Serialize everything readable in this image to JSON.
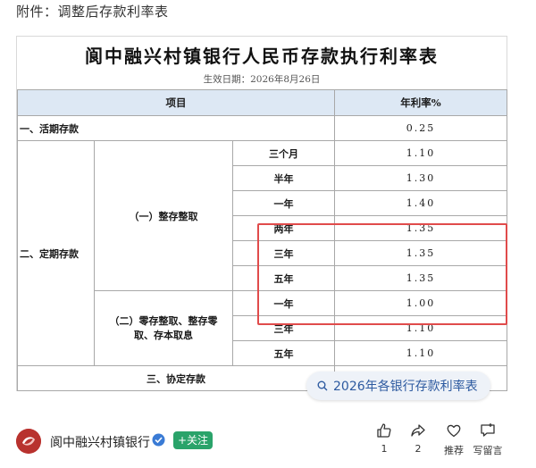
{
  "header": {
    "attachment_label": "附件：调整后存款利率表"
  },
  "document": {
    "title": "阆中融兴村镇银行人民币存款执行利率表",
    "effective_date": "生效日期：2026年8月26日",
    "table": {
      "col_item": "项目",
      "col_rate": "年利率%",
      "demand": {
        "label": "一、活期存款",
        "rate": "0.25"
      },
      "time_deposit_label": "二、定期存款",
      "lump_sum": {
        "label": "（一）整存整取",
        "rows": [
          {
            "term": "三个月",
            "rate": "1.10"
          },
          {
            "term": "半年",
            "rate": "1.30"
          },
          {
            "term": "一年",
            "rate": "1.40"
          },
          {
            "term": "两年",
            "rate": "1.35"
          },
          {
            "term": "三年",
            "rate": "1.35"
          },
          {
            "term": "五年",
            "rate": "1.35"
          }
        ]
      },
      "installment": {
        "label": "（二）零存整取、整存零取、存本取息",
        "rows": [
          {
            "term": "一年",
            "rate": "1.00"
          },
          {
            "term": "三年",
            "rate": "1.10"
          },
          {
            "term": "五年",
            "rate": "1.10"
          }
        ]
      },
      "negotiated": {
        "label": "三、协定存款"
      }
    }
  },
  "search_suggestion": {
    "text": "2026年各银行存款利率表",
    "icon": "search-icon"
  },
  "footer": {
    "account_name": "阆中融兴村镇银行",
    "follow_label": "+关注",
    "actions": [
      {
        "icon": "thumbs-up-icon",
        "label": "1"
      },
      {
        "icon": "share-icon",
        "label": "2"
      },
      {
        "icon": "heart-icon",
        "label": "推荐"
      },
      {
        "icon": "comment-icon",
        "label": "写留言"
      }
    ]
  },
  "colors": {
    "header_fill": "#dde8f4",
    "highlight": "#e04b4b",
    "follow": "#2aa36a",
    "link": "#2d5aa0"
  }
}
